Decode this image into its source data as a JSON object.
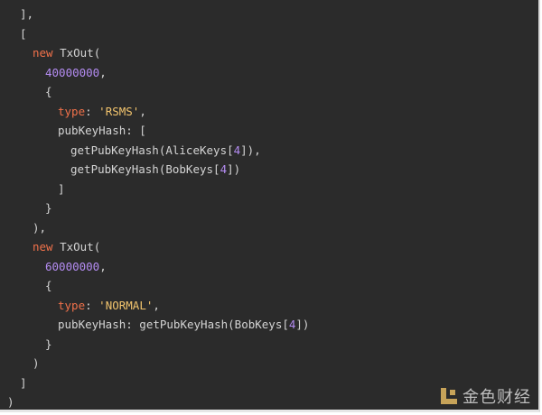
{
  "code": {
    "lines": [
      {
        "indent": "  ",
        "tokens": [
          {
            "t": "],",
            "c": "plain"
          }
        ]
      },
      {
        "indent": "  ",
        "tokens": [
          {
            "t": "[",
            "c": "plain"
          }
        ]
      },
      {
        "indent": "    ",
        "tokens": [
          {
            "t": "new",
            "c": "kw"
          },
          {
            "t": " TxOut(",
            "c": "plain"
          }
        ]
      },
      {
        "indent": "      ",
        "tokens": [
          {
            "t": "40000000",
            "c": "num"
          },
          {
            "t": ",",
            "c": "plain"
          }
        ]
      },
      {
        "indent": "      ",
        "tokens": [
          {
            "t": "{",
            "c": "plain"
          }
        ]
      },
      {
        "indent": "        ",
        "tokens": [
          {
            "t": "type",
            "c": "key"
          },
          {
            "t": ": ",
            "c": "plain"
          },
          {
            "t": "'RSMS'",
            "c": "str"
          },
          {
            "t": ",",
            "c": "plain"
          }
        ]
      },
      {
        "indent": "        ",
        "tokens": [
          {
            "t": "pubKeyHash: [",
            "c": "plain"
          }
        ]
      },
      {
        "indent": "          ",
        "tokens": [
          {
            "t": "getPubKeyHash(AliceKeys[",
            "c": "plain"
          },
          {
            "t": "4",
            "c": "idx"
          },
          {
            "t": "]),",
            "c": "plain"
          }
        ]
      },
      {
        "indent": "          ",
        "tokens": [
          {
            "t": "getPubKeyHash(BobKeys[",
            "c": "plain"
          },
          {
            "t": "4",
            "c": "idx"
          },
          {
            "t": "])",
            "c": "plain"
          }
        ]
      },
      {
        "indent": "        ",
        "tokens": [
          {
            "t": "]",
            "c": "plain"
          }
        ]
      },
      {
        "indent": "      ",
        "tokens": [
          {
            "t": "}",
            "c": "plain"
          }
        ]
      },
      {
        "indent": "    ",
        "tokens": [
          {
            "t": "),",
            "c": "plain"
          }
        ]
      },
      {
        "indent": "    ",
        "tokens": [
          {
            "t": "new",
            "c": "kw"
          },
          {
            "t": " TxOut(",
            "c": "plain"
          }
        ]
      },
      {
        "indent": "      ",
        "tokens": [
          {
            "t": "60000000",
            "c": "num"
          },
          {
            "t": ",",
            "c": "plain"
          }
        ]
      },
      {
        "indent": "      ",
        "tokens": [
          {
            "t": "{",
            "c": "plain"
          }
        ]
      },
      {
        "indent": "        ",
        "tokens": [
          {
            "t": "type",
            "c": "key"
          },
          {
            "t": ": ",
            "c": "plain"
          },
          {
            "t": "'NORMAL'",
            "c": "str"
          },
          {
            "t": ",",
            "c": "plain"
          }
        ]
      },
      {
        "indent": "        ",
        "tokens": [
          {
            "t": "pubKeyHash: getPubKeyHash(BobKeys[",
            "c": "plain"
          },
          {
            "t": "4",
            "c": "idx"
          },
          {
            "t": "])",
            "c": "plain"
          }
        ]
      },
      {
        "indent": "      ",
        "tokens": [
          {
            "t": "}",
            "c": "plain"
          }
        ]
      },
      {
        "indent": "    ",
        "tokens": [
          {
            "t": ")",
            "c": "plain"
          }
        ]
      },
      {
        "indent": "  ",
        "tokens": [
          {
            "t": "]",
            "c": "plain"
          }
        ]
      },
      {
        "indent": "",
        "tokens": [
          {
            "t": ")",
            "c": "plain"
          }
        ]
      }
    ]
  },
  "watermark": {
    "text": "金色财经",
    "logo_icon": "jinse-logo-icon"
  },
  "colors": {
    "background": "#2b2b2b",
    "keyword": "#f0714a",
    "number": "#b48cf2",
    "string": "#f2c46d",
    "text": "#d4d4d4"
  }
}
